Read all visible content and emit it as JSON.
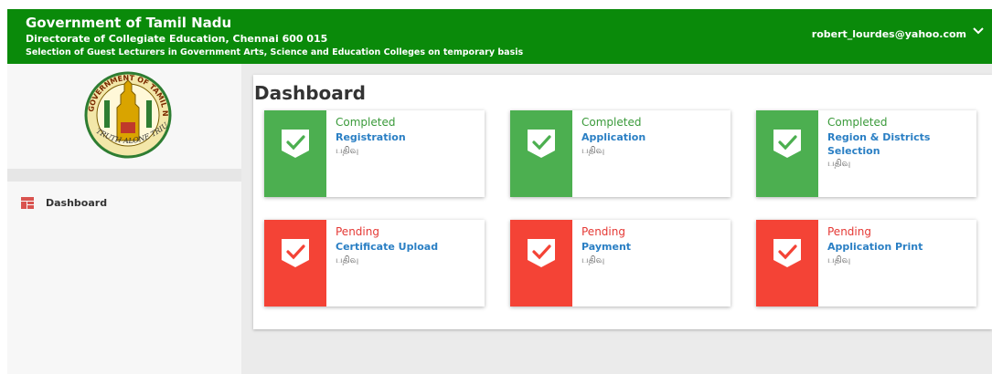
{
  "header": {
    "title": "Government of Tamil Nadu",
    "subtitle": "Directorate of Collegiate Education, Chennai 600 015",
    "tagline": "Selection of Guest Lecturers in Government Arts, Science and Education Colleges on temporary basis",
    "user_email": "robert_lourdes@yahoo.com"
  },
  "sidebar": {
    "logo_text_top": "GOVERNMENT OF TAMIL NADU",
    "logo_text_bottom": "TRUTH ALONE TRIUMPHS",
    "items": [
      {
        "label": "Dashboard",
        "icon": "dashboard-icon"
      }
    ]
  },
  "main": {
    "page_title": "Dashboard",
    "cards": [
      {
        "status": "Completed",
        "name": "Registration",
        "sub": "பதிவு",
        "state": "completed"
      },
      {
        "status": "Completed",
        "name": "Application",
        "sub": "பதிவு",
        "state": "completed"
      },
      {
        "status": "Completed",
        "name": "Region & Districts Selection",
        "sub": "பதிவு",
        "state": "completed"
      },
      {
        "status": "Pending",
        "name": "Certificate Upload",
        "sub": "பதிவு",
        "state": "pending"
      },
      {
        "status": "Pending",
        "name": "Payment",
        "sub": "பதிவு",
        "state": "pending"
      },
      {
        "status": "Pending",
        "name": "Application Print",
        "sub": "பதிவு",
        "state": "pending"
      }
    ]
  },
  "colors": {
    "header_green": "#0a8a0a",
    "completed_green": "#4caf50",
    "pending_red": "#f44336",
    "link_blue": "#2a7fc4"
  }
}
